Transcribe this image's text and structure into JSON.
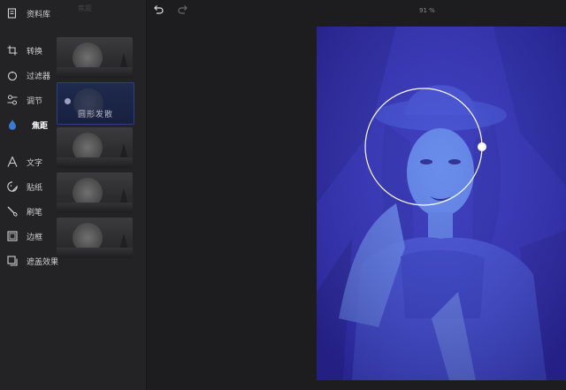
{
  "sidebar": {
    "items": [
      {
        "label": "资料库",
        "icon": "library-icon"
      },
      {
        "label": "转换",
        "icon": "crop-rotate-icon"
      },
      {
        "label": "过滤器",
        "icon": "filter-icon"
      },
      {
        "label": "调节",
        "icon": "adjust-sliders-icon"
      },
      {
        "label": "焦距",
        "icon": "focus-drop-icon"
      },
      {
        "label": "文字",
        "icon": "text-icon"
      },
      {
        "label": "贴纸",
        "icon": "sticker-icon"
      },
      {
        "label": "刷笔",
        "icon": "brush-icon"
      },
      {
        "label": "边框",
        "icon": "frame-icon"
      },
      {
        "label": "遮盖效果",
        "icon": "overlay-icon"
      }
    ],
    "active_index": 4,
    "faded_header": "焦距"
  },
  "focus_options": [
    {
      "label": ""
    },
    {
      "label": "圆形发散",
      "selected": true
    },
    {
      "label": ""
    },
    {
      "label": ""
    },
    {
      "label": ""
    }
  ],
  "toolbar": {
    "undo_icon": "undo-icon",
    "redo_icon": "redo-icon",
    "zoom": "91 %"
  },
  "colors": {
    "accent": "#2b3f86",
    "photo_tint": "#3a3ac0",
    "focus_ring": "#ffffff"
  }
}
